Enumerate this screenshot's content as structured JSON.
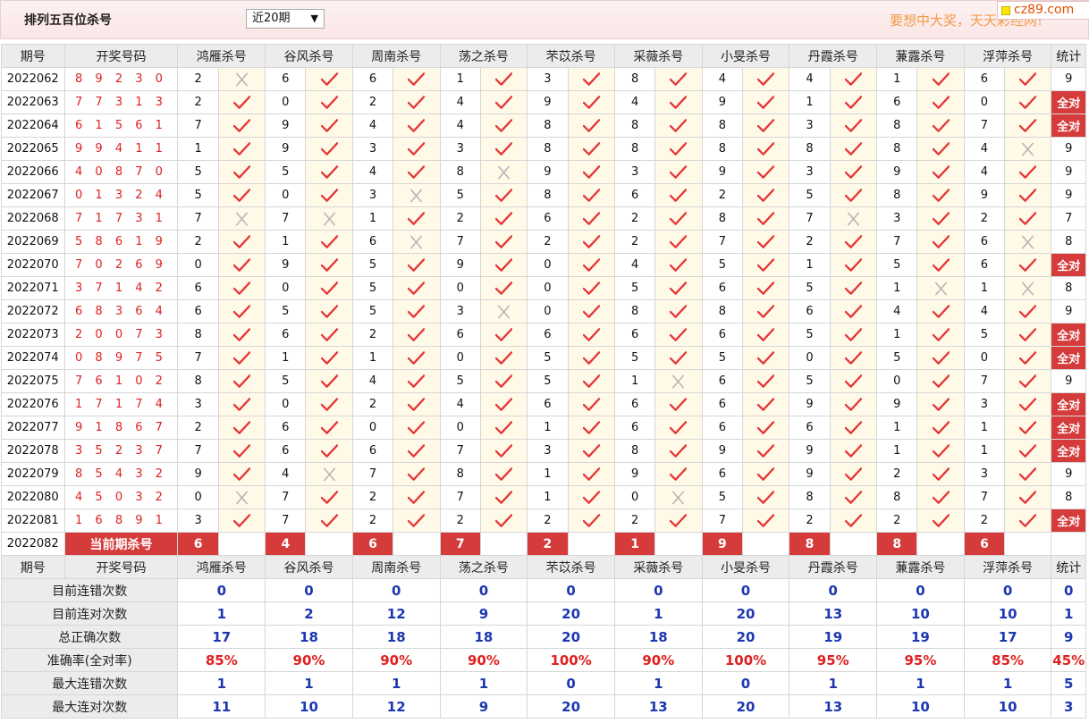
{
  "header": {
    "title": "排列五百位杀号",
    "select_value": "近20期",
    "slogan": "要想中大奖，天天彩经网!",
    "logo": "cz89.com"
  },
  "columns": {
    "period": "期号",
    "draw": "开奖号码",
    "experts": [
      "鸿雁杀号",
      "谷风杀号",
      "周南杀号",
      "荡之杀号",
      "芣苡杀号",
      "采薇杀号",
      "小旻杀号",
      "丹霞杀号",
      "蒹露杀号",
      "浮萍杀号"
    ],
    "stat": "统计"
  },
  "rows": [
    {
      "p": "2022062",
      "d": "8 9 2 3 0",
      "k": [
        2,
        6,
        6,
        1,
        3,
        8,
        4,
        4,
        1,
        6
      ],
      "ok": [
        0,
        1,
        1,
        1,
        1,
        1,
        1,
        1,
        1,
        1
      ],
      "s": "9"
    },
    {
      "p": "2022063",
      "d": "7 7 3 1 3",
      "k": [
        2,
        0,
        2,
        4,
        9,
        4,
        9,
        1,
        6,
        0
      ],
      "ok": [
        1,
        1,
        1,
        1,
        1,
        1,
        1,
        1,
        1,
        1
      ],
      "s": "全对"
    },
    {
      "p": "2022064",
      "d": "6 1 5 6 1",
      "k": [
        7,
        9,
        4,
        4,
        8,
        8,
        8,
        3,
        8,
        7
      ],
      "ok": [
        1,
        1,
        1,
        1,
        1,
        1,
        1,
        1,
        1,
        1
      ],
      "s": "全对"
    },
    {
      "p": "2022065",
      "d": "9 9 4 1 1",
      "k": [
        1,
        9,
        3,
        3,
        8,
        8,
        8,
        8,
        8,
        4
      ],
      "ok": [
        1,
        1,
        1,
        1,
        1,
        1,
        1,
        1,
        1,
        0
      ],
      "s": "9"
    },
    {
      "p": "2022066",
      "d": "4 0 8 7 0",
      "k": [
        5,
        5,
        4,
        8,
        9,
        3,
        9,
        3,
        9,
        4
      ],
      "ok": [
        1,
        1,
        1,
        0,
        1,
        1,
        1,
        1,
        1,
        1
      ],
      "s": "9"
    },
    {
      "p": "2022067",
      "d": "0 1 3 2 4",
      "k": [
        5,
        0,
        3,
        5,
        8,
        6,
        2,
        5,
        8,
        9
      ],
      "ok": [
        1,
        1,
        0,
        1,
        1,
        1,
        1,
        1,
        1,
        1
      ],
      "s": "9"
    },
    {
      "p": "2022068",
      "d": "7 1 7 3 1",
      "k": [
        7,
        7,
        1,
        2,
        6,
        2,
        8,
        7,
        3,
        2
      ],
      "ok": [
        0,
        0,
        1,
        1,
        1,
        1,
        1,
        0,
        1,
        1
      ],
      "s": "7"
    },
    {
      "p": "2022069",
      "d": "5 8 6 1 9",
      "k": [
        2,
        1,
        6,
        7,
        2,
        2,
        7,
        2,
        7,
        6
      ],
      "ok": [
        1,
        1,
        0,
        1,
        1,
        1,
        1,
        1,
        1,
        0
      ],
      "s": "8"
    },
    {
      "p": "2022070",
      "d": "7 0 2 6 9",
      "k": [
        0,
        9,
        5,
        9,
        0,
        4,
        5,
        1,
        5,
        6
      ],
      "ok": [
        1,
        1,
        1,
        1,
        1,
        1,
        1,
        1,
        1,
        1
      ],
      "s": "全对"
    },
    {
      "p": "2022071",
      "d": "3 7 1 4 2",
      "k": [
        6,
        0,
        5,
        0,
        0,
        5,
        6,
        5,
        1,
        1
      ],
      "ok": [
        1,
        1,
        1,
        1,
        1,
        1,
        1,
        1,
        0,
        0
      ],
      "s": "8"
    },
    {
      "p": "2022072",
      "d": "6 8 3 6 4",
      "k": [
        6,
        5,
        5,
        3,
        0,
        8,
        8,
        6,
        4,
        4
      ],
      "ok": [
        1,
        1,
        1,
        0,
        1,
        1,
        1,
        1,
        1,
        1
      ],
      "s": "9"
    },
    {
      "p": "2022073",
      "d": "2 0 0 7 3",
      "k": [
        8,
        6,
        2,
        6,
        6,
        6,
        6,
        5,
        1,
        5
      ],
      "ok": [
        1,
        1,
        1,
        1,
        1,
        1,
        1,
        1,
        1,
        1
      ],
      "s": "全对"
    },
    {
      "p": "2022074",
      "d": "0 8 9 7 5",
      "k": [
        7,
        1,
        1,
        0,
        5,
        5,
        5,
        0,
        5,
        0
      ],
      "ok": [
        1,
        1,
        1,
        1,
        1,
        1,
        1,
        1,
        1,
        1
      ],
      "s": "全对"
    },
    {
      "p": "2022075",
      "d": "7 6 1 0 2",
      "k": [
        8,
        5,
        4,
        5,
        5,
        1,
        6,
        5,
        0,
        7
      ],
      "ok": [
        1,
        1,
        1,
        1,
        1,
        0,
        1,
        1,
        1,
        1
      ],
      "s": "9"
    },
    {
      "p": "2022076",
      "d": "1 7 1 7 4",
      "k": [
        3,
        0,
        2,
        4,
        6,
        6,
        6,
        9,
        9,
        3
      ],
      "ok": [
        1,
        1,
        1,
        1,
        1,
        1,
        1,
        1,
        1,
        1
      ],
      "s": "全对"
    },
    {
      "p": "2022077",
      "d": "9 1 8 6 7",
      "k": [
        2,
        6,
        0,
        0,
        1,
        6,
        6,
        6,
        1,
        1
      ],
      "ok": [
        1,
        1,
        1,
        1,
        1,
        1,
        1,
        1,
        1,
        1
      ],
      "s": "全对"
    },
    {
      "p": "2022078",
      "d": "3 5 2 3 7",
      "k": [
        7,
        6,
        6,
        7,
        3,
        8,
        9,
        9,
        1,
        1
      ],
      "ok": [
        1,
        1,
        1,
        1,
        1,
        1,
        1,
        1,
        1,
        1
      ],
      "s": "全对"
    },
    {
      "p": "2022079",
      "d": "8 5 4 3 2",
      "k": [
        9,
        4,
        7,
        8,
        1,
        9,
        6,
        9,
        2,
        3
      ],
      "ok": [
        1,
        0,
        1,
        1,
        1,
        1,
        1,
        1,
        1,
        1
      ],
      "s": "9"
    },
    {
      "p": "2022080",
      "d": "4 5 0 3 2",
      "k": [
        0,
        7,
        2,
        7,
        1,
        0,
        5,
        8,
        8,
        7
      ],
      "ok": [
        0,
        1,
        1,
        1,
        1,
        0,
        1,
        1,
        1,
        1
      ],
      "s": "8"
    },
    {
      "p": "2022081",
      "d": "1 6 8 9 1",
      "k": [
        3,
        7,
        2,
        2,
        2,
        2,
        7,
        2,
        2,
        2
      ],
      "ok": [
        1,
        1,
        1,
        1,
        1,
        1,
        1,
        1,
        1,
        1
      ],
      "s": "全对"
    }
  ],
  "current": {
    "period": "2022082",
    "label": "当前期杀号",
    "kills": [
      "6",
      "4",
      "6",
      "7",
      "2",
      "1",
      "9",
      "8",
      "8",
      "6"
    ]
  },
  "stats": [
    {
      "label": "目前连错次数",
      "vals": [
        "0",
        "0",
        "0",
        "0",
        "0",
        "0",
        "0",
        "0",
        "0",
        "0"
      ],
      "stat": "0",
      "cls": "blue"
    },
    {
      "label": "目前连对次数",
      "vals": [
        "1",
        "2",
        "12",
        "9",
        "20",
        "1",
        "20",
        "13",
        "10",
        "10"
      ],
      "stat": "1",
      "cls": "blue"
    },
    {
      "label": "总正确次数",
      "vals": [
        "17",
        "18",
        "18",
        "18",
        "20",
        "18",
        "20",
        "19",
        "19",
        "17"
      ],
      "stat": "9",
      "cls": "blue"
    },
    {
      "label": "准确率(全对率)",
      "vals": [
        "85%",
        "90%",
        "90%",
        "90%",
        "100%",
        "90%",
        "100%",
        "95%",
        "95%",
        "85%"
      ],
      "stat": "45%",
      "cls": "red"
    },
    {
      "label": "最大连错次数",
      "vals": [
        "1",
        "1",
        "1",
        "1",
        "0",
        "1",
        "0",
        "1",
        "1",
        "1"
      ],
      "stat": "5",
      "cls": "blue"
    },
    {
      "label": "最大连对次数",
      "vals": [
        "11",
        "10",
        "12",
        "9",
        "20",
        "13",
        "20",
        "13",
        "10",
        "10"
      ],
      "stat": "3",
      "cls": "blue"
    }
  ],
  "colors": {
    "correct": "#e53434",
    "wrong": "#b4b4b4",
    "highlight": "#d63b3b",
    "blue": "#1c37b0"
  }
}
